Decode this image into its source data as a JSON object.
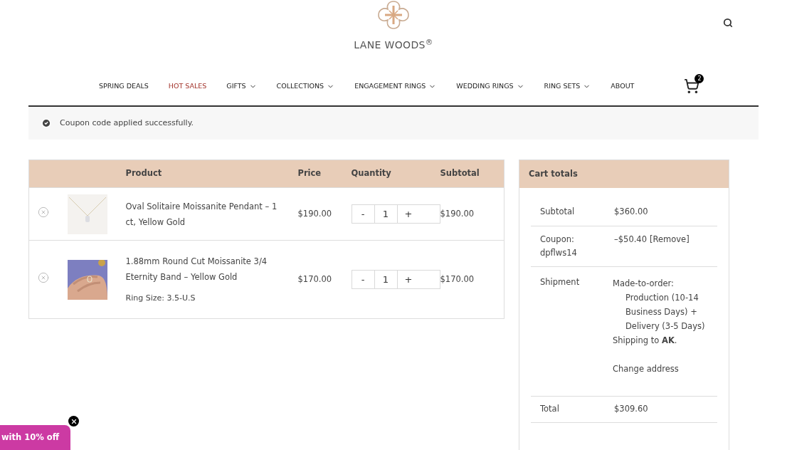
{
  "brand": {
    "name": "LANE WOODS$^{®}$"
  },
  "cart": {
    "count": "2"
  },
  "nav": [
    {
      "label": "SPRING DEALS",
      "selected": false,
      "dropdown": false
    },
    {
      "label": "HOT SALES",
      "selected": true,
      "dropdown": false
    },
    {
      "label": "GIFTS",
      "selected": false,
      "dropdown": true
    },
    {
      "label": "COLLECTIONS",
      "selected": false,
      "dropdown": true
    },
    {
      "label": "ENGAGEMENT RINGS",
      "selected": false,
      "dropdown": true
    },
    {
      "label": "WEDDING RINGS",
      "selected": false,
      "dropdown": true
    },
    {
      "label": "RING SETS",
      "selected": false,
      "dropdown": true
    },
    {
      "label": "ABOUT",
      "selected": false,
      "dropdown": false
    }
  ],
  "notice": {
    "message": "Coupon code applied successfully."
  },
  "table": {
    "columns": [
      "Product",
      "Price",
      "Quantity",
      "Subtotal"
    ],
    "rows": [
      {
        "product": "Oval Solitaire Moissanite Pendant – 1 ct, Yellow Gold",
        "price": "$190.00",
        "quantity": "1",
        "subtotal": "$190.00"
      },
      {
        "product": "1.88mm Round Cut Moissanite 3/4 Eternity Band – Yellow Gold",
        "variation": "Ring Size: 3.5-U.S",
        "price": "$170.00",
        "quantity": "1",
        "subtotal": "$170.00"
      }
    ],
    "minus": "-",
    "plus": "+"
  },
  "totals": {
    "title": "Cart totals",
    "subtotal": {
      "label": "Subtotal",
      "value": "$360.00"
    },
    "coupon": {
      "label": "Coupon: dpflws14",
      "value": "–$50.40",
      "action": "[Remove]"
    },
    "shipment": {
      "label": "Shipment",
      "method": "Made-to-order:",
      "detail": "Production (10-14 Business Days) + Delivery (3-5 Days)",
      "destination": "Shipping to **AK**.",
      "action": "Change address"
    },
    "total": {
      "label": "Total",
      "value": "$309.60"
    }
  },
  "promo": {
    "label": "with 10% off"
  }
}
